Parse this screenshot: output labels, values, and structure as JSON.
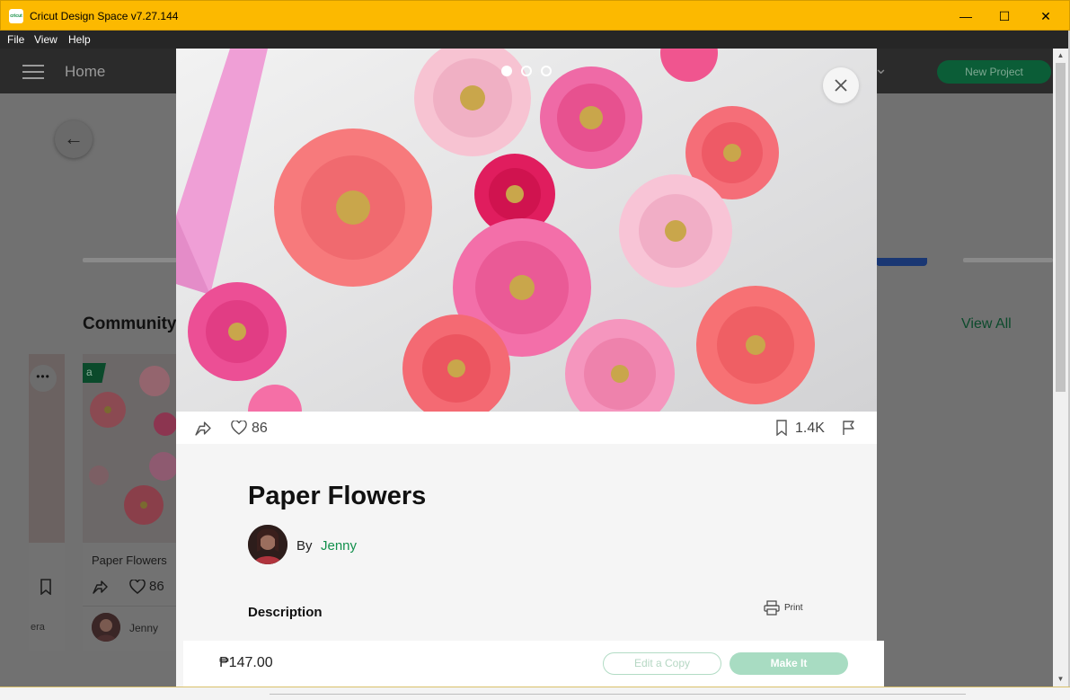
{
  "window": {
    "title": "Cricut Design Space  v7.27.144",
    "app_icon_text": "cricut",
    "controls": {
      "minimize": "—",
      "maximize": "☐",
      "close": "✕"
    }
  },
  "menu": {
    "file": "File",
    "view": "View",
    "help": "Help"
  },
  "header": {
    "home": "Home",
    "new_project": "New Project"
  },
  "background": {
    "back_arrow": "←",
    "community_title": "Community",
    "view_all": "View All",
    "left_card": {
      "author_fragment": "era",
      "more": "•••"
    },
    "main_card": {
      "badge": "a",
      "title": "Paper Flowers",
      "likes": "86",
      "author": "Jenny"
    }
  },
  "modal": {
    "likes": "86",
    "saves": "1.4K",
    "title": "Paper Flowers",
    "by": "By",
    "author": "Jenny",
    "description_label": "Description",
    "print_label": "Print",
    "price": "₱147.00",
    "edit_copy": "Edit a Copy",
    "make_it": "Make It",
    "carousel": {
      "count": 3,
      "active": 1
    }
  },
  "colors": {
    "title_bar": "#fcb900",
    "brand_green": "#12904c",
    "make_it_button": "#a8dcc2",
    "overlay": "#717171"
  },
  "icons": {
    "share": "share-icon",
    "like": "heart-icon",
    "bookmark": "bookmark-icon",
    "flag": "flag-icon",
    "close": "close-icon",
    "print": "printer-icon",
    "menu": "hamburger-icon"
  }
}
